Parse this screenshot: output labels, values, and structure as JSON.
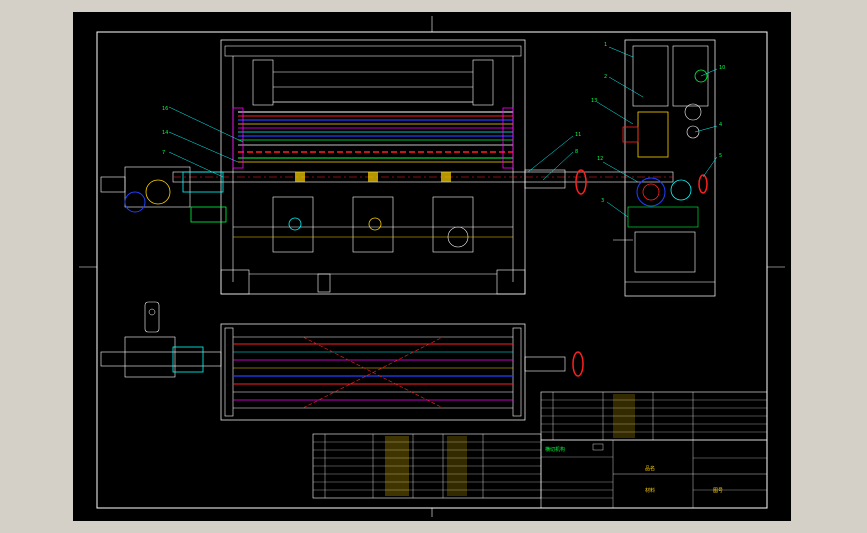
{
  "sheet": {
    "callouts_front": [
      "16",
      "14",
      "7",
      "11",
      "8"
    ],
    "callouts_side": [
      "1",
      "2",
      "10",
      "13",
      "4",
      "5",
      "12",
      "3"
    ],
    "title_block": {
      "drawing_title": "横切机构",
      "material_label": "材料",
      "figure_label": "图号",
      "company": "品名"
    }
  }
}
